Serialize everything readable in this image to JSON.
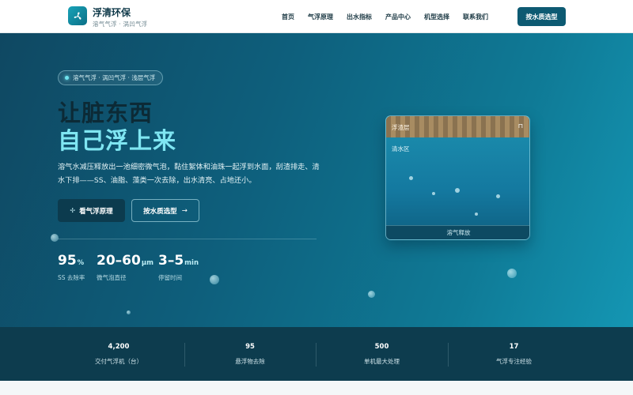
{
  "header": {
    "brand_name": "浮清环保",
    "brand_sub": "溶气气浮 · 涡凹气浮",
    "nav": [
      "首页",
      "气浮原理",
      "出水指标",
      "产品中心",
      "机型选择",
      "联系我们"
    ],
    "cta": "按水质选型"
  },
  "hero": {
    "pill": "溶气气浮 · 涡凹气浮 · 浅层气浮",
    "title_line1": "让脏东西",
    "title_line2": "自己浮上来",
    "description": "溶气水减压释放出一池细密微气泡，黏住絮体和油珠一起浮到水面，刮渣排走、清水下排——SS、油脂、藻类一次去除，出水清亮、占地还小。",
    "btn_primary": "看气浮原理",
    "btn_secondary": "按水质选型",
    "stats": [
      {
        "value": "95",
        "unit": "%",
        "label": "SS 去除率"
      },
      {
        "value": "20–60",
        "unit": "μm",
        "label": "微气泡直径"
      },
      {
        "value": "3–5",
        "unit": "min",
        "label": "停留时间"
      }
    ]
  },
  "tank": {
    "top_label": "浮渣层",
    "clear_label": "清水区",
    "bottom_label": "溶气释放"
  },
  "band": [
    {
      "value": "4,200",
      "label": "交付气浮机（台）"
    },
    {
      "value": "95",
      "label": "悬浮物去除"
    },
    {
      "value": "500",
      "label": "单机最大处理"
    },
    {
      "value": "17",
      "label": "气浮专注经验"
    }
  ],
  "colors": {
    "accent": "#7fe6f2",
    "brand_dark": "#0d5a72",
    "band_bg": "#0d3c4e"
  },
  "icons": {
    "logo": "fan-icon",
    "primary_button": "fan-icon",
    "secondary_button": "arrow-right-icon",
    "tank_top": "scraper-icon"
  }
}
